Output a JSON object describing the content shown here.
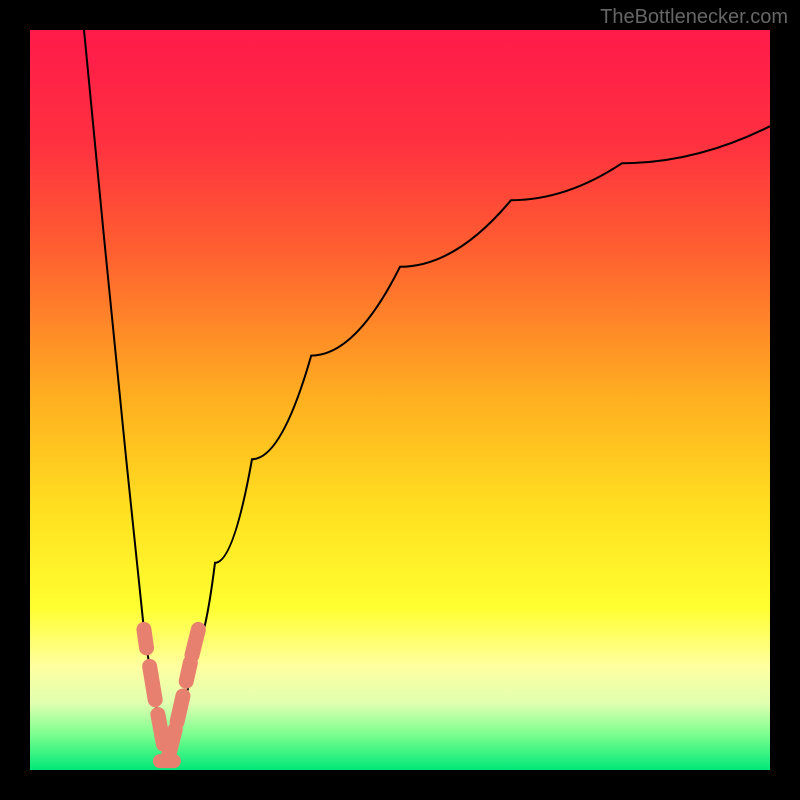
{
  "watermark": "TheBottlenecker.com",
  "gradient": {
    "stops": [
      {
        "offset": 0,
        "color": "#ff1a4a"
      },
      {
        "offset": 0.15,
        "color": "#ff3040"
      },
      {
        "offset": 0.3,
        "color": "#ff6030"
      },
      {
        "offset": 0.5,
        "color": "#ffb020"
      },
      {
        "offset": 0.65,
        "color": "#ffe020"
      },
      {
        "offset": 0.78,
        "color": "#ffff30"
      },
      {
        "offset": 0.86,
        "color": "#ffffa0"
      },
      {
        "offset": 0.91,
        "color": "#e0ffb0"
      },
      {
        "offset": 0.95,
        "color": "#80ff90"
      },
      {
        "offset": 1.0,
        "color": "#00e878"
      }
    ]
  },
  "chart_data": {
    "type": "line",
    "title": "",
    "xlabel": "",
    "ylabel": "",
    "xlim": [
      0,
      1
    ],
    "ylim": [
      0,
      1
    ],
    "minimum_x": 0.185,
    "series": [
      {
        "name": "bottleneck-curve",
        "description": "V-shaped bottleneck curve with minimum near x≈0.185; left branch starts at top (y≈1 at x≈0.07) descending steeply to minimum (y≈0.01), right branch rises asymptotically toward y≈0.87 at x=1",
        "left_branch": [
          {
            "x": 0.073,
            "y": 1.0
          },
          {
            "x": 0.1,
            "y": 0.72
          },
          {
            "x": 0.13,
            "y": 0.42
          },
          {
            "x": 0.155,
            "y": 0.18
          },
          {
            "x": 0.17,
            "y": 0.09
          },
          {
            "x": 0.185,
            "y": 0.01
          }
        ],
        "right_branch": [
          {
            "x": 0.185,
            "y": 0.01
          },
          {
            "x": 0.2,
            "y": 0.07
          },
          {
            "x": 0.22,
            "y": 0.16
          },
          {
            "x": 0.25,
            "y": 0.28
          },
          {
            "x": 0.3,
            "y": 0.42
          },
          {
            "x": 0.38,
            "y": 0.56
          },
          {
            "x": 0.5,
            "y": 0.68
          },
          {
            "x": 0.65,
            "y": 0.77
          },
          {
            "x": 0.8,
            "y": 0.82
          },
          {
            "x": 1.0,
            "y": 0.87
          }
        ]
      }
    ],
    "markers": {
      "description": "Salmon-colored rounded segment markers clustered near the minimum of the V, on both branches, between roughly y=0.02 and y=0.18",
      "color": "#e88070",
      "positions": [
        {
          "branch": "left",
          "y_start": 0.165,
          "y_end": 0.19
        },
        {
          "branch": "left",
          "y_start": 0.095,
          "y_end": 0.14
        },
        {
          "branch": "left",
          "y_start": 0.035,
          "y_end": 0.075
        },
        {
          "branch": "bottom",
          "y": 0.012
        },
        {
          "branch": "right",
          "y_start": 0.02,
          "y_end": 0.055
        },
        {
          "branch": "right",
          "y_start": 0.065,
          "y_end": 0.1
        },
        {
          "branch": "right",
          "y_start": 0.12,
          "y_end": 0.145
        },
        {
          "branch": "right",
          "y_start": 0.155,
          "y_end": 0.19
        }
      ]
    }
  }
}
